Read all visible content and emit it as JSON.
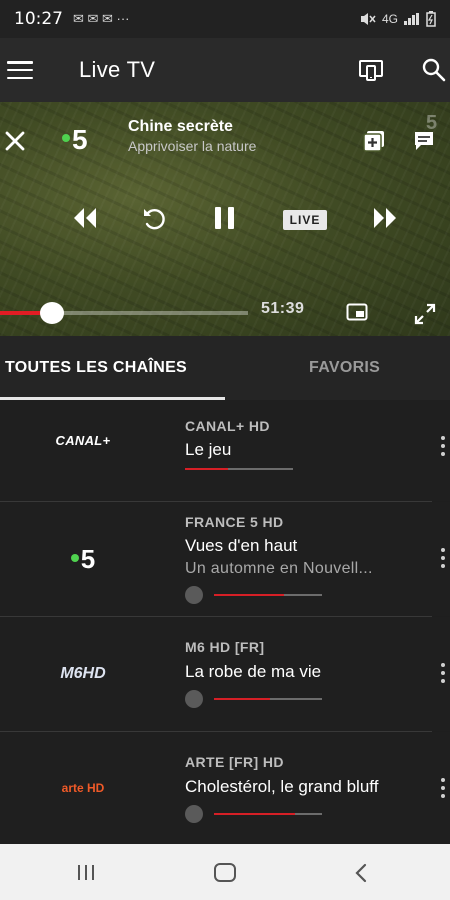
{
  "status_bar": {
    "time": "10:27",
    "notif": "✉ ✉ ✉ ···",
    "network": "4G"
  },
  "app_bar": {
    "title": "Live TV"
  },
  "player": {
    "channel_number": "5",
    "title": "Chine secrète",
    "subtitle": "Apprivoiser la nature",
    "watermark": "5",
    "live_label": "LIVE",
    "timecode": "51:39",
    "progress": 0.09
  },
  "tabs": [
    {
      "label": "TOUTES LES CHAÎNES",
      "active": true
    },
    {
      "label": "FAVORIS",
      "active": false
    }
  ],
  "channels": [
    {
      "logo": "CANAL+",
      "name": "CANAL+ HD",
      "title": "Le jeu",
      "subtitle": "",
      "progress": 0.4,
      "replay": false
    },
    {
      "logo": "5",
      "name": "FRANCE 5 HD",
      "title": "Vues d'en haut",
      "subtitle": "Un automne en Nouvell...",
      "progress": 0.65,
      "replay": true
    },
    {
      "logo": "M6HD",
      "name": "M6 HD [FR]",
      "title": "La robe de ma vie",
      "subtitle": "",
      "progress": 0.52,
      "replay": true
    },
    {
      "logo": "arte HD",
      "name": "ARTE [FR] HD",
      "title": "Cholestérol, le grand bluff",
      "subtitle": "",
      "progress": 0.75,
      "replay": true
    }
  ],
  "colors": {
    "accent": "#e21c24",
    "bg": "#1f1f1f",
    "live_dot": "#4fd24f"
  }
}
